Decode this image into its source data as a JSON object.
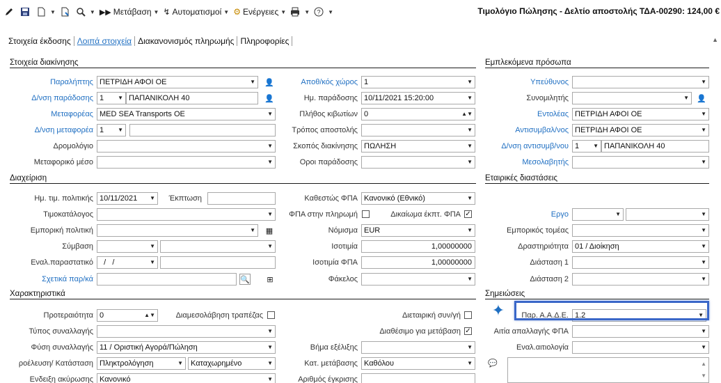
{
  "toolbar": {
    "metavasi": "Μετάβαση",
    "automatismoi": "Αυτοματισμοί",
    "energeies": "Ενέργειες"
  },
  "doc_title": "Τιμολόγιο Πώλησης - Δελτίο αποστολής ΤΔΑ-00290: 124,00 €",
  "tabs": [
    "Στοιχεία έκδοσης",
    "Λοιπά στοιχεία",
    "Διακανονισμός πληρωμής",
    "Πληροφορίες"
  ],
  "sections": {
    "stoixeia_diakinisis": "Στοιχεία διακίνησης",
    "emplekomena": "Εμπλεκόμενα πρόσωπα",
    "diaxeirisi": "Διαχείριση",
    "etairikes": "Εταιρικές διαστάσεις",
    "xaraktiristika": "Χαρακτηριστικά",
    "simeioseis": "Σημειώσεις"
  },
  "left": {
    "paraliptis_lbl": "Παραλήπτης",
    "paraliptis_val": "ΠΕΤΡΙΔΗ ΑΦΟΙ ΟΕ",
    "dnsi_paradosis_lbl": "Δ/νση παράδοσης",
    "dnsi_paradosis_num": "1",
    "dnsi_paradosis_val": "ΠΑΠΑΝΙΚΟΛΗ 40",
    "metaforeas_lbl": "Μεταφορέας",
    "metaforeas_val": "MED SEA Transports ΟΕ",
    "dnsi_metaforea_lbl": "Δ/νση μεταφορέα",
    "dnsi_metaforea_num": "1",
    "dromologio_lbl": "Δρομολόγιο",
    "metaforiko_lbl": "Μεταφορικό μέσο"
  },
  "mid": {
    "apothikos_lbl": "Αποθ/κός χώρος",
    "apothikos_val": "1",
    "im_paradosis_lbl": "Ημ. παράδοσης",
    "im_paradosis_val": "10/11/2021 15:20:00",
    "plithos_lbl": "Πλήθος κιβωτίων",
    "plithos_val": "0",
    "tropos_lbl": "Τρόπος αποστολής",
    "skopos_lbl": "Σκοπός διακίνησης",
    "skopos_val": "ΠΩΛΗΣΗ",
    "oroi_lbl": "Οροι παράδοσης"
  },
  "right": {
    "ypeythinos_lbl": "Υπεύθυνος",
    "synomilitis_lbl": "Συνομιλητής",
    "entoleas_lbl": "Εντολέας",
    "entoleas_val": "ΠΕΤΡΙΔΗ ΑΦΟΙ ΟΕ",
    "antisymv_lbl": "Αντισυμβαλ/νος",
    "antisymv_val": "ΠΕΤΡΙΔΗ ΑΦΟΙ ΟΕ",
    "dnsi_antisymv_lbl": "Δ/νση αντισυμβ/νου",
    "dnsi_antisymv_num": "1",
    "dnsi_antisymv_val": "ΠΑΠΑΝΙΚΟΛΗ 40",
    "mesolavitis_lbl": "Μεσολαβητής"
  },
  "diax": {
    "im_tim_lbl": "Ημ. τιμ. πολιτικής",
    "im_tim_val": "10/11/2021",
    "ekptosi_lbl": "Έκπτωση",
    "timokatalogos_lbl": "Τιμοκατάλογος",
    "emporiki_lbl": "Εμπορική πολιτική",
    "symvasi_lbl": "Σύμβαση",
    "enal_lbl": "Εναλ.παραστατικό",
    "enal_val": "  /   /",
    "sxetika_lbl": "Σχετικά παρ/κά",
    "kathestos_lbl": "Καθεστώς ΦΠΑ",
    "kathestos_val": "Κανονικό (Εθνικό)",
    "fpa_pliromi_lbl": "ΦΠΑ στην πληρωμή",
    "dikaioma_lbl": "Δικαίωμα έκπτ. ΦΠΑ",
    "nomisma_lbl": "Νόμισμα",
    "nomisma_val": "EUR",
    "isotimia_lbl": "Ισοτιμία",
    "isotimia_val": "1,00000000",
    "isotimia_fpa_lbl": "Ισοτιμία ΦΠΑ",
    "isotimia_fpa_val": "1,00000000",
    "fakelos_lbl": "Φάκελος"
  },
  "etair": {
    "ergo_lbl": "Εργο",
    "emporikos_lbl": "Εμπορικός τομέας",
    "drastiriotita_lbl": "Δραστηριότητα",
    "drastiriotita_val": "01 / Διοίκηση",
    "diastasi1_lbl": "Διάσταση 1",
    "diastasi2_lbl": "Διάσταση 2"
  },
  "xar": {
    "proteraiotita_lbl": "Προτεραιότητα",
    "proteraiotita_val": "0",
    "diamesolavisi_lbl": "Διαμεσολάβηση τραπέζας",
    "dietairiki_lbl": "Διεταιρική συν/γή",
    "typos_lbl": "Τύπος συναλλαγής",
    "diathesimo_lbl": "Διαθέσιμο για μετάβαση",
    "fysi_lbl": "Φύση συναλλαγής",
    "fysi_val": "11 / Οριστική Αγορά/Πώληση",
    "vima_lbl": "Βήμα εξέλιξης",
    "proeleusi_lbl": "ροέλευση/ Κατάσταση",
    "proeleusi_val": "Πληκτρολόγηση",
    "katastasi_val": "Καταχωρημένο",
    "kat_metavasis_lbl": "Κατ. μετάβασης",
    "kat_metavasis_val": "Καθόλου",
    "endeixi_lbl": "Ενδειξη ακύρωσης",
    "endeixi_val": "Κανονικό",
    "arithmos_lbl": "Αριθμός έγκρισης"
  },
  "simeioseis": {
    "par_aade_lbl": "Παρ. Α.Α.Δ.Ε.",
    "par_aade_val": "1.2",
    "aitia_lbl": "Αιτία απαλλαγής ΦΠΑ",
    "enal_aitiologia_lbl": "Εναλ.αιτιολογία"
  },
  "colors": {
    "link": "#1f6fc2",
    "highlight": "#3a67c8"
  }
}
